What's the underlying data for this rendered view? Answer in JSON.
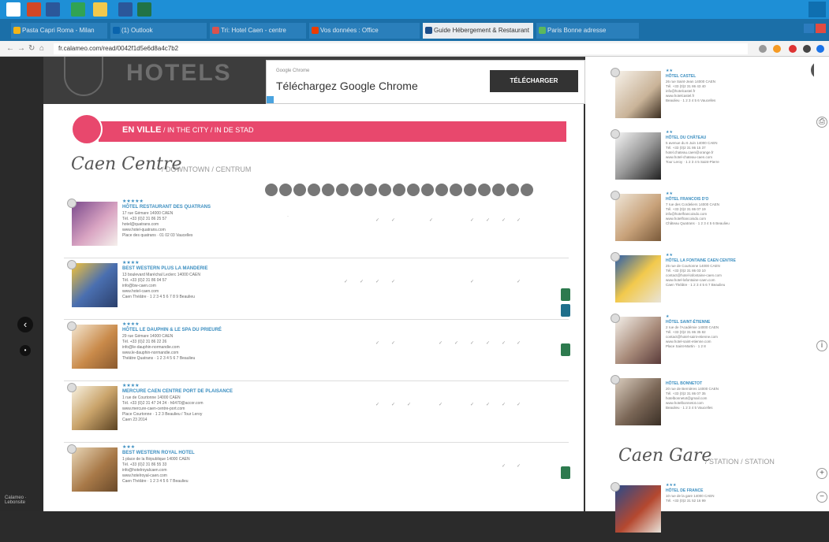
{
  "browser": {
    "tabs": [
      {
        "label": "Pasta Capri Roma - Milan"
      },
      {
        "label": "(1) Outlook"
      },
      {
        "label": "Tri: Hotel Caen - centre"
      },
      {
        "label": "Vos données : Office"
      },
      {
        "label": "Guide Hébergement & Restaurant",
        "active": true
      },
      {
        "label": "Paris Bonne adresse"
      }
    ],
    "url": "fr.calameo.com/read/0042f1d5e6d8a4c7b2"
  },
  "ad": {
    "small": "Google Chrome",
    "title": "Téléchargez Google Chrome",
    "button": "TÉLÉCHARGER"
  },
  "left_page": {
    "banner": "HOTELS",
    "section": {
      "title": "EN VILLE",
      "subtitle": " / IN THE CITY / IN DE STAD"
    },
    "area_title": "Caen Centre",
    "area_sub": "/ DOWNTOWN / CENTRUM",
    "hotels": [
      {
        "stars": "★★★★★",
        "name": "HÔTEL RESTAURANT DES QUATRANS",
        "l1": "17 rue Gémare 14000 CAEN",
        "l2": "Tél. +33 (0)2 31 86 25 57",
        "l3": "hotel@quatrans.com",
        "l4": "www.hotel-quatrans.com",
        "l5": "Place des quatrans · 01 02 03 Vaucelles"
      },
      {
        "stars": "★★★★",
        "name": "BEST WESTERN PLUS LA MANDERIE",
        "l1": "13 boulevard Maréchal Leclerc 14000 CAEN",
        "l2": "Tél. +33 (0)2 31 86 04 57",
        "l3": "info@bw-caen.com",
        "l4": "www.hotel-caen.com",
        "l5": "Caen Théâtre · 1 2 3 4 5 6 7 8 9 Beaulieu"
      },
      {
        "stars": "★★★★",
        "name": "HÔTEL LE DAUPHIN & LE SPA DU PRIEURÉ",
        "l1": "29 rue Gémare 14000 CAEN",
        "l2": "Tél. +33 (0)2 31 86 22 26",
        "l3": "info@le-dauphin-normandie.com",
        "l4": "www.le-dauphin-normandie.com",
        "l5": "Théâtre Quatrans · 1 2 3 4 5 6 7 Beaulieu"
      },
      {
        "stars": "★★★★",
        "name": "MERCURE CAEN CENTRE PORT DE PLAISANCE",
        "l1": "1 rue de Courtonne 14000 CAEN",
        "l2": "Tél. +33 (0)2 31 47 24 24 · h6470@accor.com",
        "l3": "www.mercure-caen-centre-port.com",
        "l4": "Place Courtonne · 1 2 3 Beaulieu / Tour Leroy",
        "l5": "Caen 23 2014"
      },
      {
        "stars": "★★★",
        "name": "BEST WESTERN ROYAL HOTEL",
        "l1": "1 place de la République 14000 CAEN",
        "l2": "Tél. +33 (0)2 31 86 55 33",
        "l3": "info@hotelroyalcaen.com",
        "l4": "www.hotelroyal-caen.com",
        "l5": "Caen Théâtre · 1 2 3 4 5 6 7 Beaulieu"
      }
    ]
  },
  "right_page": {
    "hotels": [
      {
        "stars": "★★",
        "name": "HÔTEL CASTEL",
        "l1": "26 rue Saint-Jean 14000 CAEN",
        "l2": "Tél. +33 (0)2 31 86 43 40",
        "l3": "info@hotelcastel.fr",
        "l4": "www.hotelcastel.fr",
        "l5": "Beaulieu · 1 2 3 4 5 6 Vaucelles"
      },
      {
        "stars": "★★",
        "name": "HÔTEL DU CHÂTEAU",
        "l1": "5 avenue du 6 Juin 14000 CAEN",
        "l2": "Tél. +33 (0)2 31 86 15 37",
        "l3": "hotel.chateau.caen@orange.fr",
        "l4": "www.hotel-chateau-caen.com",
        "l5": "Tour Leroy · 1 2 3 4 5 Saint-Pierre"
      },
      {
        "stars": "★★",
        "name": "HÔTEL FRANCOIS D'O",
        "l1": "7 rue des Cordeliers 14000 CAEN",
        "l2": "Tél. +33 (0)2 31 86 07 19",
        "l3": "info@hotelfrancoisdo.com",
        "l4": "www.hotelfrancoisdo.com",
        "l5": "Château Quatrans · 1 2 3 4 5 6 Beaulieu"
      },
      {
        "stars": "★★",
        "name": "HÔTEL LA FONTAINE CAEN CENTRE",
        "l1": "25 rue de Courtonne 14000 CAEN",
        "l2": "Tél. +33 (0)2 31 86 03 10",
        "l3": "contact@hotel-lafontaine-caen.com",
        "l4": "www.hotel-lafontaine-caen.com",
        "l5": "Caen Théâtre · 1 2 3 4 5 6 7 Beaulieu"
      },
      {
        "stars": "★",
        "name": "HÔTEL SAINT-ÉTIENNE",
        "l1": "2 rue de l'Académie 14000 CAEN",
        "l2": "Tél. +33 (0)2 31 86 35 82",
        "l3": "contact@hotel-saint-etienne.com",
        "l4": "www.hotel-saint-etienne.com",
        "l5": "Place Saint-Martin · 1 2 8"
      },
      {
        "stars": "",
        "name": "HÔTEL BONNETOT",
        "l1": "20 rue de Bernières 14000 CAEN",
        "l2": "Tél. +33 (0)2 31 86 07 35",
        "l3": "hotelbonnetot@gmail.com",
        "l4": "www.hotelbonnetot.com",
        "l5": "Beaulieu · 1 2 3 4 5 Vaucelles"
      }
    ],
    "area2_title": "Caen Gare",
    "area2_sub": "/ STATION / STATION",
    "hotel_gare": {
      "stars": "★★★",
      "name": "HÔTEL DE FRANCE",
      "l1": "10 rue de la gare 14000 CAEN",
      "l2": "Tél. +33 (0)2 31 52 16 99"
    }
  },
  "left_footer": "Calameo · Lebonsite"
}
